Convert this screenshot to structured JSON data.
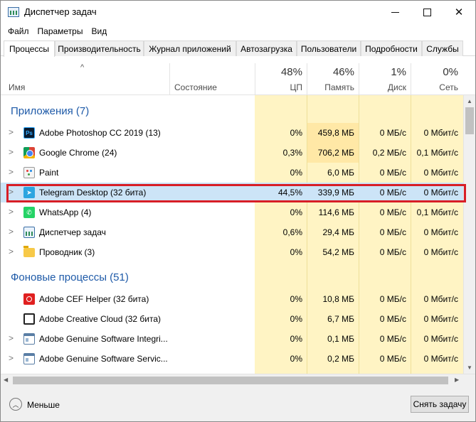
{
  "window": {
    "title": "Диспетчер задач"
  },
  "menu": [
    "Файл",
    "Параметры",
    "Вид"
  ],
  "tabs": [
    "Процессы",
    "Производительность",
    "Журнал приложений",
    "Автозагрузка",
    "Пользователи",
    "Подробности",
    "Службы"
  ],
  "active_tab": "Процессы",
  "columns": {
    "name": "Имя",
    "status": "Состояние",
    "cpu": {
      "pct": "48%",
      "label": "ЦП"
    },
    "memory": {
      "pct": "46%",
      "label": "Память"
    },
    "disk": {
      "pct": "1%",
      "label": "Диск"
    },
    "network": {
      "pct": "0%",
      "label": "Сеть"
    }
  },
  "groups": {
    "apps": "Приложения (7)",
    "background": "Фоновые процессы (51)"
  },
  "apps": [
    {
      "name": "Adobe Photoshop CC 2019 (13)",
      "icon": "photoshop-icon",
      "cpu": "0%",
      "mem": "459,8 МБ",
      "disk": "0 МБ/с",
      "net": "0 Мбит/с"
    },
    {
      "name": "Google Chrome (24)",
      "icon": "chrome-icon",
      "cpu": "0,3%",
      "mem": "706,2 МБ",
      "disk": "0,2 МБ/с",
      "net": "0,1 Мбит/с"
    },
    {
      "name": "Paint",
      "icon": "paint-icon",
      "cpu": "0%",
      "mem": "6,0 МБ",
      "disk": "0 МБ/с",
      "net": "0 Мбит/с"
    },
    {
      "name": "Telegram Desktop (32 бита)",
      "icon": "telegram-icon",
      "cpu": "44,5%",
      "mem": "339,9 МБ",
      "disk": "0 МБ/с",
      "net": "0 Мбит/с"
    },
    {
      "name": "WhatsApp (4)",
      "icon": "whatsapp-icon",
      "cpu": "0%",
      "mem": "114,6 МБ",
      "disk": "0 МБ/с",
      "net": "0,1 Мбит/с"
    },
    {
      "name": "Диспетчер задач",
      "icon": "task-manager-icon",
      "cpu": "0,6%",
      "mem": "29,4 МБ",
      "disk": "0 МБ/с",
      "net": "0 Мбит/с"
    },
    {
      "name": "Проводник (3)",
      "icon": "folder-icon",
      "cpu": "0%",
      "mem": "54,2 МБ",
      "disk": "0 МБ/с",
      "net": "0 Мбит/с"
    }
  ],
  "background": [
    {
      "name": "Adobe CEF Helper (32 бита)",
      "icon": "adobe-cef-icon",
      "cpu": "0%",
      "mem": "10,8 МБ",
      "disk": "0 МБ/с",
      "net": "0 Мбит/с"
    },
    {
      "name": "Adobe Creative Cloud (32 бита)",
      "icon": "creative-cloud-icon",
      "cpu": "0%",
      "mem": "6,7 МБ",
      "disk": "0 МБ/с",
      "net": "0 Мбит/с"
    },
    {
      "name": "Adobe Genuine Software Integri...",
      "icon": "generic-app-icon",
      "cpu": "0%",
      "mem": "0,1 МБ",
      "disk": "0 МБ/с",
      "net": "0 Мбит/с"
    },
    {
      "name": "Adobe Genuine Software Servic...",
      "icon": "generic-app-icon",
      "cpu": "0%",
      "mem": "0,2 МБ",
      "disk": "0 МБ/с",
      "net": "0 Мбит/с"
    }
  ],
  "footer": {
    "less": "Меньше",
    "end_task": "Снять задачу"
  },
  "colors": {
    "heat": "#fff4c4",
    "heat_strong": "#ffe8a6",
    "selected": "#cce4f7",
    "highlight_border": "#d81e26",
    "group_text": "#1e5aa8"
  }
}
